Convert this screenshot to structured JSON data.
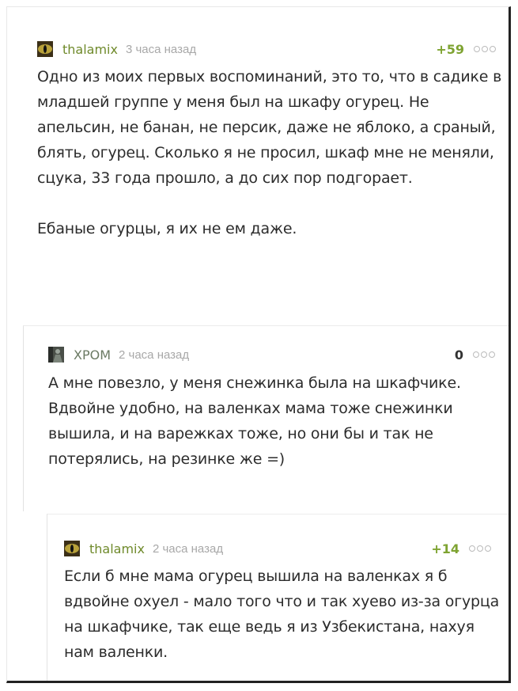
{
  "comments": [
    {
      "author": "thalamix",
      "time": "3 часа назад",
      "rating": "+59",
      "avatar_icon": "cat-eye-avatar",
      "text": "Одно из моих первых воспоминаний, это то, что в садике в младшей группе у меня был на шкафу огурец. Не апельсин, не банан, не персик, даже не яблоко, а сраный, блять, огурец. Сколько я не просил, шкаф мне не меняли, сцука, 33 года прошло, а до сих пор подгорает.\n\nЕбаные огурцы, я их не ем даже."
    },
    {
      "author": "ХРОМ",
      "time": "2 часа назад",
      "rating": "0",
      "avatar_icon": "person-avatar",
      "text": "А мне повезло, у меня снежинка была на шкафчике. Вдвойне удобно, на валенках мама тоже снежинки вышила, и на варежках тоже, но они бы и так не потерялись, на резинке же =)"
    },
    {
      "author": "thalamix",
      "time": "2 часа назад",
      "rating": "+14",
      "avatar_icon": "cat-eye-avatar",
      "text": "Если б мне мама огурец вышила на валенках я б вдвойне охуел - мало того что и так хуево из-за огурца на шкафчике, так еще ведь я из Узбекистана, нахуя нам валенки."
    }
  ],
  "colors": {
    "author": "#6f8a2b",
    "time": "#a8a8a8",
    "rating_positive": "#7ea331",
    "text": "#2c2c2c"
  }
}
